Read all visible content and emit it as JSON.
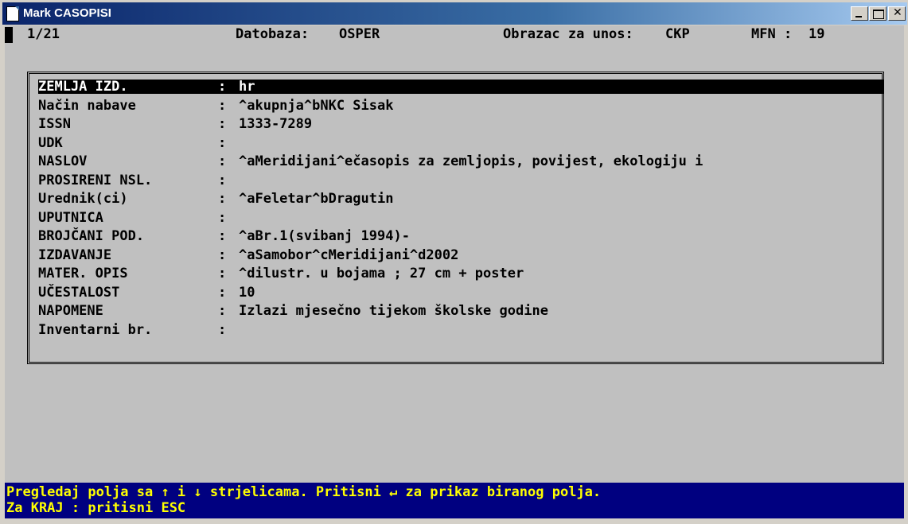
{
  "window": {
    "title": "Mark CASOPISI",
    "min_label": "_",
    "close_label": "✕"
  },
  "status": {
    "record": "1/21",
    "database_label": "Datobaza:",
    "database_value": "OSPER",
    "form_label": "Obrazac za unos:",
    "form_value": "CKP",
    "mfn_label": "MFN :",
    "mfn_value": "19"
  },
  "fields": [
    {
      "label": "ZEMLJA IZD.",
      "colon": ":",
      "value": "hr"
    },
    {
      "label": "Način nabave",
      "colon": ":",
      "value": "^akupnja^bNKC Sisak"
    },
    {
      "label": "ISSN",
      "colon": ":",
      "value": "1333-7289"
    },
    {
      "label": "UDK",
      "colon": ":",
      "value": ""
    },
    {
      "label": "NASLOV",
      "colon": ":",
      "value": "^aMeridijani^ečasopis za zemljopis, povijest, ekologiju i"
    },
    {
      "label": "PROSIRENI NSL.",
      "colon": ":",
      "value": ""
    },
    {
      "label": "Urednik(ci)",
      "colon": ":",
      "value": "^aFeletar^bDragutin"
    },
    {
      "label": "UPUTNICA",
      "colon": ":",
      "value": ""
    },
    {
      "label": "BROJČANI POD.",
      "colon": ":",
      "value": "^aBr.1(svibanj 1994)-"
    },
    {
      "label": "IZDAVANJE",
      "colon": ":",
      "value": "^aSamobor^cMeridijani^d2002"
    },
    {
      "label": "MATER. OPIS",
      "colon": ":",
      "value": "^dilustr. u bojama ; 27 cm + poster"
    },
    {
      "label": "UČESTALOST",
      "colon": ":",
      "value": "10"
    },
    {
      "label": "NAPOMENE",
      "colon": ":",
      "value": "Izlazi mjesečno tijekom školske godine"
    },
    {
      "label": "Inventarni br.",
      "colon": ":",
      "value": ""
    }
  ],
  "help": {
    "line1": "Pregledaj polja sa ↑ i ↓ strjelicama. Pritisni ↵ za prikaz biranog polja.",
    "line2": "Za KRAJ : pritisni ESC"
  },
  "colors": {
    "help_bg": "#000080",
    "help_fg": "#ffff00",
    "console_bg": "#c0c0c0"
  }
}
